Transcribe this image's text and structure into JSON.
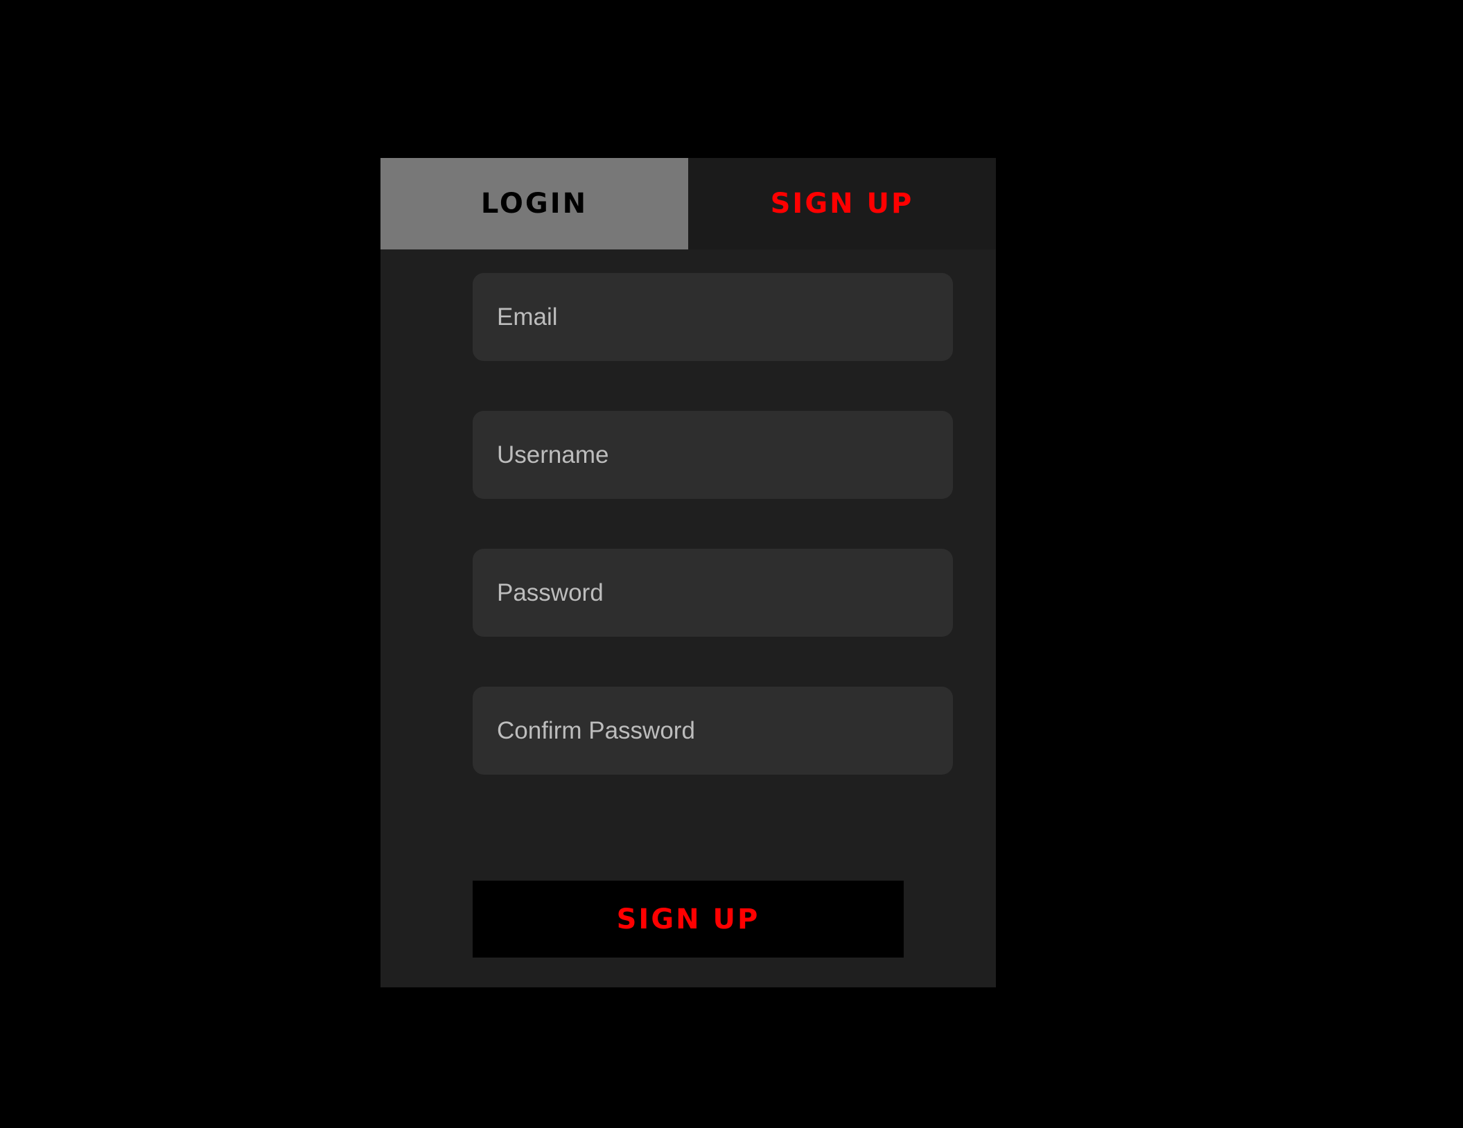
{
  "tabs": {
    "login_label": "LOGIN",
    "signup_label": "SIGN UP",
    "active": "LOGIN"
  },
  "form": {
    "email_placeholder": "Email",
    "username_placeholder": "Username",
    "password_placeholder": "Password",
    "confirm_password_placeholder": "Confirm Password",
    "email_value": "",
    "username_value": "",
    "password_value": "",
    "confirm_password_value": "",
    "submit_label": "SIGN UP"
  },
  "colors": {
    "page_background": "#000000",
    "panel_background": "#1f1f1f",
    "active_tab_background": "#787878",
    "inactive_tab_background": "#1b1b1b",
    "accent_red": "#ff0000",
    "field_background": "#2e2e2e",
    "placeholder_text": "#bdbdbd"
  }
}
